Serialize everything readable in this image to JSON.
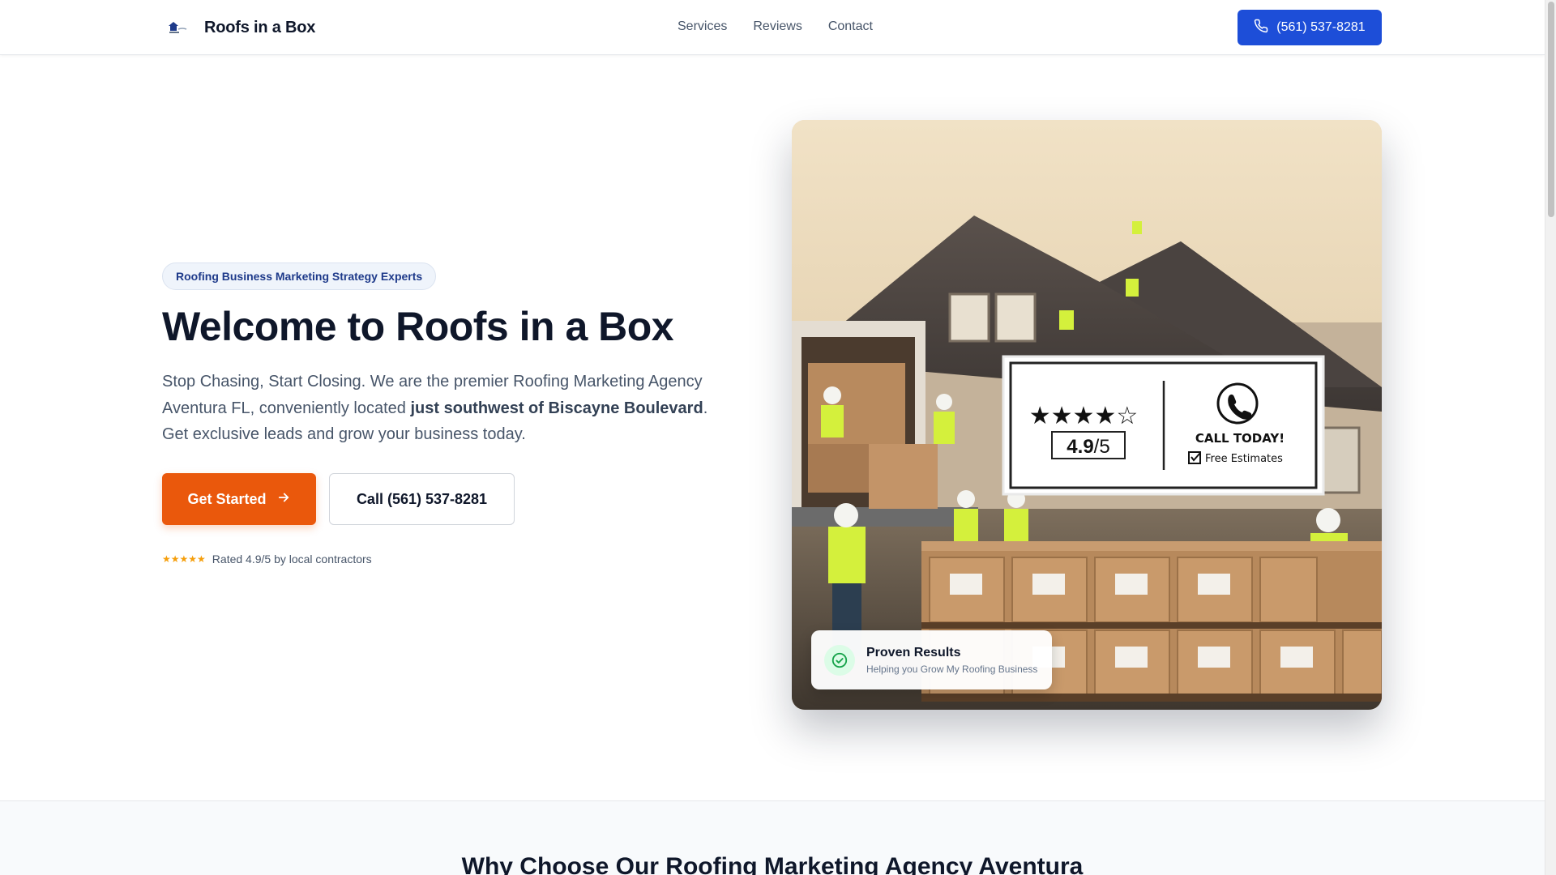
{
  "header": {
    "brand": "Roofs in a Box",
    "nav": [
      {
        "label": "Services"
      },
      {
        "label": "Reviews"
      },
      {
        "label": "Contact"
      }
    ],
    "call_label": "(561) 537-8281"
  },
  "hero": {
    "badge": "Roofing Business Marketing Strategy Experts",
    "title": "Welcome to Roofs in a Box",
    "desc_part1": "Stop Chasing, Start Closing. We are the premier Roofing Marketing Agency Aventura FL, conveniently located ",
    "desc_bold": "just southwest of Biscayne Boulevard",
    "desc_part2": ". Get exclusive leads and grow your business today.",
    "primary_cta": "Get Started",
    "secondary_cta": "Call (561) 537-8281",
    "rating_stars": "★★★★★",
    "rating_text": "Rated 4.9/5 by local contractors"
  },
  "hero_image": {
    "sign_rating": "4.9/5",
    "sign_rating_main": "4.9",
    "sign_rating_denominator": "/5",
    "sign_call": "CALL TODAY!",
    "sign_estimates": "Free Estimates",
    "overlay_title": "Proven Results",
    "overlay_sub": "Helping you Grow My Roofing Business"
  },
  "section2": {
    "title": "Why Choose Our Roofing Marketing Agency Aventura"
  },
  "colors": {
    "primary_blue": "#1d4ed8",
    "accent_orange": "#ea580c",
    "success_green": "#16a34a",
    "star_amber": "#f59e0b"
  },
  "icons": {
    "header_call": "phone-icon",
    "primary_cta": "arrow-right-icon",
    "proven": "check-circle-icon",
    "sign_phone": "phone-ring-icon",
    "sign_check": "checkbox-icon"
  }
}
